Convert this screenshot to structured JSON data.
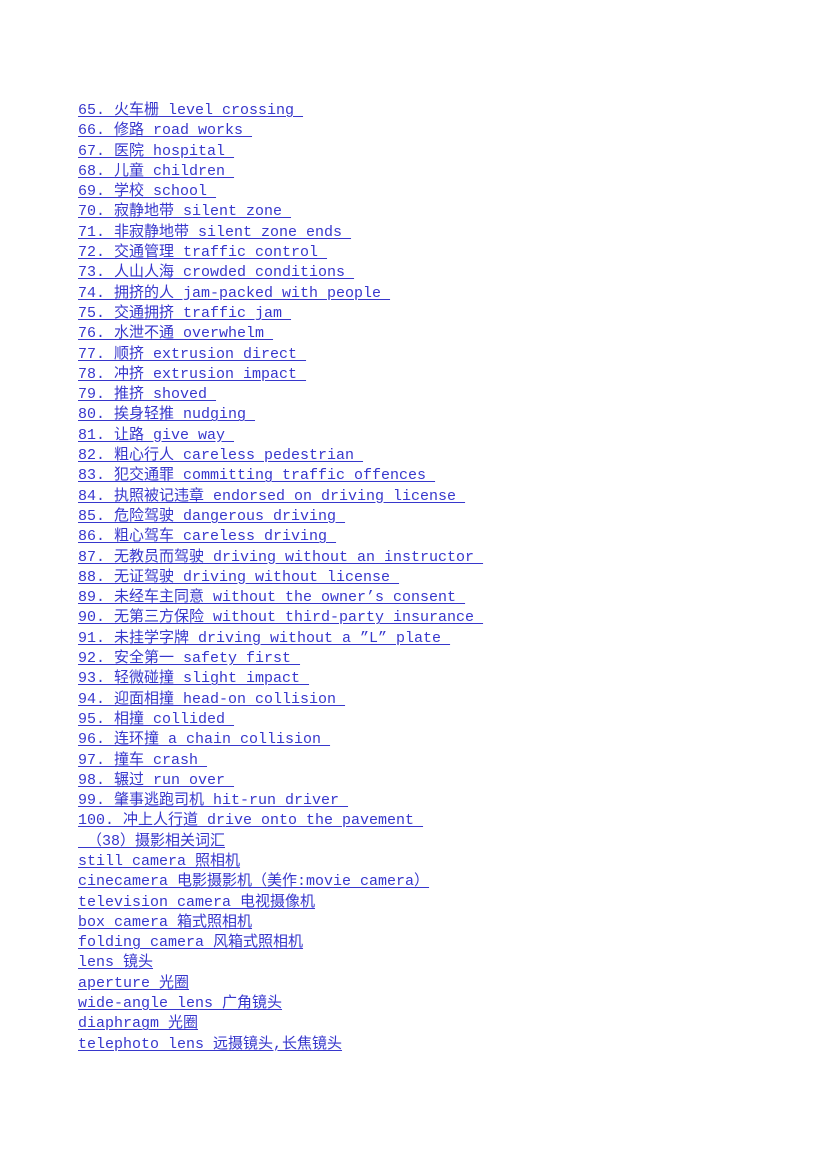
{
  "document": {
    "text_color": "#3737cc",
    "background_color": "#ffffff",
    "lines": [
      {
        "id": "line-65",
        "text": "65. 火车栅 level crossing "
      },
      {
        "id": "line-66",
        "text": "66. 修路 road works "
      },
      {
        "id": "line-67",
        "text": "67. 医院 hospital "
      },
      {
        "id": "line-68",
        "text": "68. 儿童 children "
      },
      {
        "id": "line-69",
        "text": "69. 学校 school "
      },
      {
        "id": "line-70",
        "text": "70. 寂静地带 silent zone "
      },
      {
        "id": "line-71",
        "text": "71. 非寂静地带 silent zone ends "
      },
      {
        "id": "line-72",
        "text": "72. 交通管理 traffic control "
      },
      {
        "id": "line-73",
        "text": "73. 人山人海 crowded conditions "
      },
      {
        "id": "line-74",
        "text": "74. 拥挤的人 jam-packed with people "
      },
      {
        "id": "line-75",
        "text": "75. 交通拥挤 traffic jam "
      },
      {
        "id": "line-76",
        "text": "76. 水泄不通 overwhelm "
      },
      {
        "id": "line-77",
        "text": "77. 顺挤 extrusion direct "
      },
      {
        "id": "line-78",
        "text": "78. 冲挤 extrusion impact "
      },
      {
        "id": "line-79",
        "text": "79. 推挤 shoved "
      },
      {
        "id": "line-80",
        "text": "80. 挨身轻推 nudging "
      },
      {
        "id": "line-81",
        "text": "81. 让路 give way "
      },
      {
        "id": "line-82",
        "text": "82. 粗心行人 careless pedestrian "
      },
      {
        "id": "line-83",
        "text": "83. 犯交通罪 committing traffic offences "
      },
      {
        "id": "line-84",
        "text": "84. 执照被记违章 endorsed on driving license "
      },
      {
        "id": "line-85",
        "text": "85. 危险驾驶 dangerous driving "
      },
      {
        "id": "line-86",
        "text": "86. 粗心驾车 careless driving "
      },
      {
        "id": "line-87",
        "text": "87. 无教员而驾驶 driving without an instructor "
      },
      {
        "id": "line-88",
        "text": "88. 无证驾驶 driving without license "
      },
      {
        "id": "line-89",
        "text": "89. 未经车主同意 without the owner’s consent "
      },
      {
        "id": "line-90",
        "text": "90. 无第三方保险 without third-party insurance "
      },
      {
        "id": "line-91",
        "text": "91. 未挂学字牌 driving without a ”L” plate "
      },
      {
        "id": "line-92",
        "text": "92. 安全第一 safety first "
      },
      {
        "id": "line-93",
        "text": "93. 轻微碰撞 slight impact "
      },
      {
        "id": "line-94",
        "text": "94. 迎面相撞 head-on collision "
      },
      {
        "id": "line-95",
        "text": "95. 相撞 collided "
      },
      {
        "id": "line-96",
        "text": "96. 连环撞 a chain collision "
      },
      {
        "id": "line-97",
        "text": "97. 撞车 crash "
      },
      {
        "id": "line-98",
        "text": "98. 辗过 run over "
      },
      {
        "id": "line-99",
        "text": "99. 肇事逃跑司机 hit-run driver "
      },
      {
        "id": "line-100",
        "text": "100. 冲上人行道 drive onto the pavement "
      },
      {
        "id": "section-heading-38",
        "text": " （38）摄影相关词汇"
      },
      {
        "id": "line-still-camera",
        "text": "still camera 照相机"
      },
      {
        "id": "line-cinecamera",
        "text": "cinecamera 电影摄影机（美作:movie camera）"
      },
      {
        "id": "line-television-camera",
        "text": "television camera 电视摄像机"
      },
      {
        "id": "line-box-camera",
        "text": "box camera 箱式照相机"
      },
      {
        "id": "line-folding-camera",
        "text": "folding camera 风箱式照相机"
      },
      {
        "id": "line-lens",
        "text": "lens 镜头"
      },
      {
        "id": "line-aperture",
        "text": "aperture 光圈"
      },
      {
        "id": "line-wide-angle-lens",
        "text": "wide-angle lens 广角镜头"
      },
      {
        "id": "line-diaphragm",
        "text": "diaphragm 光圈"
      },
      {
        "id": "line-telephoto-lens",
        "text": "telephoto lens 远摄镜头,长焦镜头"
      }
    ]
  }
}
